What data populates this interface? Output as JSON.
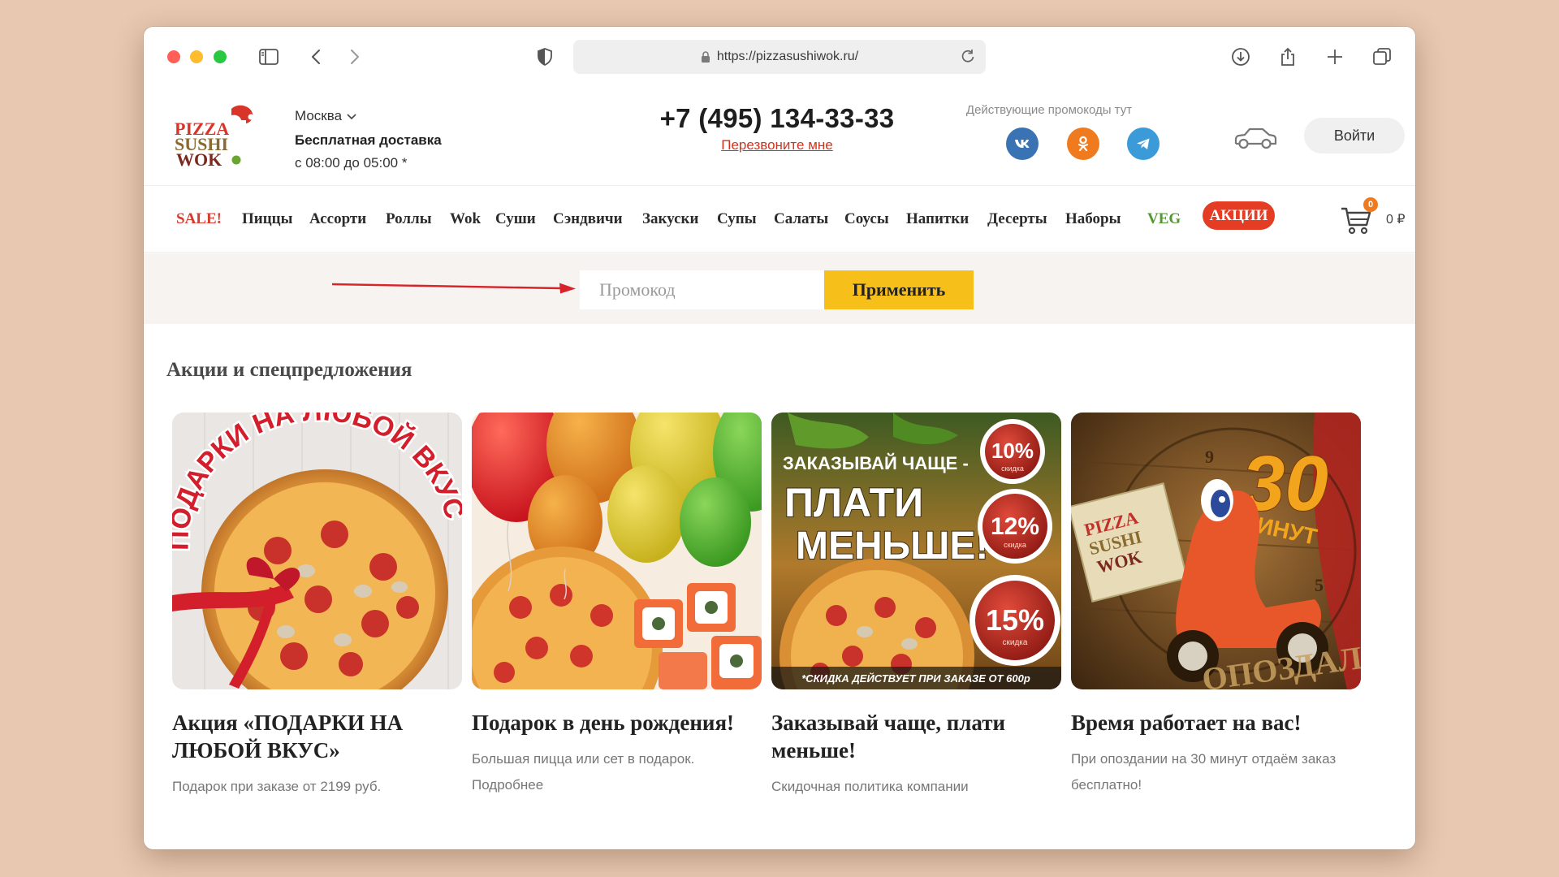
{
  "browser": {
    "url": "https://pizzasushiwok.ru/"
  },
  "header": {
    "logo_text": [
      "PIZZA",
      "SUSHI",
      "WOK"
    ],
    "city": "Москва",
    "delivery": "Бесплатная доставка",
    "hours": "с 08:00 до 05:00 *",
    "phone": "+7 (495) 134-33-33",
    "callback": "Перезвоните мне",
    "promo_hint": "Действующие промокоды тут",
    "login": "Войти"
  },
  "nav": {
    "items": [
      {
        "label": "SALE!"
      },
      {
        "label": "Пиццы"
      },
      {
        "label": "Ассорти"
      },
      {
        "label": "Роллы"
      },
      {
        "label": "Wok"
      },
      {
        "label": "Суши"
      },
      {
        "label": "Сэндвичи"
      },
      {
        "label": "Закуски"
      },
      {
        "label": "Супы"
      },
      {
        "label": "Салаты"
      },
      {
        "label": "Соусы"
      },
      {
        "label": "Напитки"
      },
      {
        "label": "Десерты"
      },
      {
        "label": "Наборы"
      },
      {
        "label": "VEG"
      }
    ],
    "akcii": "АКЦИИ",
    "cart_count": "0",
    "cart_sum": "0 ₽"
  },
  "promo": {
    "placeholder": "Промокод",
    "apply": "Применить"
  },
  "offers": {
    "title": "Акции и спецпредложения",
    "cards": [
      {
        "title": "Акция «ПОДАРКИ НА ЛЮБОЙ ВКУС»",
        "subtitle": "Подарок при заказе от 2199 руб.",
        "image_text": "ПОДАРКИ НА ЛЮБОЙ ВКУС"
      },
      {
        "title": "Подарок в день рождения!",
        "subtitle": "Большая пицца или сет в подарок. Подробнее"
      },
      {
        "title": "Заказывай чаще, плати меньше!",
        "subtitle": "Скидочная политика компании",
        "image_text": {
          "line1": "ЗАКАЗЫВАЙ ЧАЩЕ -",
          "line2": "ПЛАТИ",
          "line3": "МЕНЬШЕ!",
          "badge1": "10%",
          "badge2": "12%",
          "badge3": "15%",
          "badge_sub": "скидка",
          "footnote": "*СКИДКА ДЕЙСТВУЕТ ПРИ ЗАКАЗЕ ОТ 600р"
        }
      },
      {
        "title": "Время работает на вас!",
        "subtitle": "При опоздании на 30 минут отдаём заказ бесплатно!",
        "image_text": {
          "number": "30",
          "unit": "МИНУТ",
          "late": "ОПОЗДАЛ",
          "box": [
            "PIZZA",
            "SUSHI",
            "WOK"
          ]
        }
      }
    ]
  },
  "colors": {
    "accent_red": "#e53c24",
    "apply_yellow": "#f7bf1a",
    "veg_green": "#4f9a2c",
    "backdrop": "#e8c8b0"
  }
}
